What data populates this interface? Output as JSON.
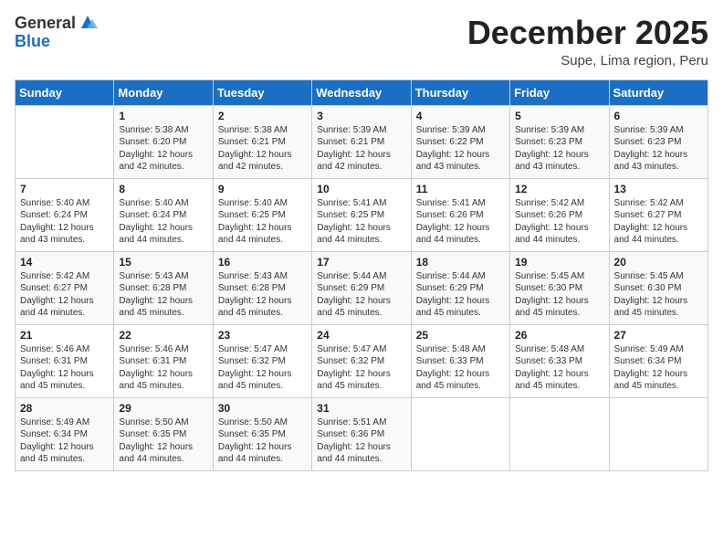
{
  "header": {
    "logo_general": "General",
    "logo_blue": "Blue",
    "month_title": "December 2025",
    "subtitle": "Supe, Lima region, Peru"
  },
  "days_of_week": [
    "Sunday",
    "Monday",
    "Tuesday",
    "Wednesday",
    "Thursday",
    "Friday",
    "Saturday"
  ],
  "weeks": [
    [
      {
        "day": "",
        "info": ""
      },
      {
        "day": "1",
        "info": "Sunrise: 5:38 AM\nSunset: 6:20 PM\nDaylight: 12 hours\nand 42 minutes."
      },
      {
        "day": "2",
        "info": "Sunrise: 5:38 AM\nSunset: 6:21 PM\nDaylight: 12 hours\nand 42 minutes."
      },
      {
        "day": "3",
        "info": "Sunrise: 5:39 AM\nSunset: 6:21 PM\nDaylight: 12 hours\nand 42 minutes."
      },
      {
        "day": "4",
        "info": "Sunrise: 5:39 AM\nSunset: 6:22 PM\nDaylight: 12 hours\nand 43 minutes."
      },
      {
        "day": "5",
        "info": "Sunrise: 5:39 AM\nSunset: 6:23 PM\nDaylight: 12 hours\nand 43 minutes."
      },
      {
        "day": "6",
        "info": "Sunrise: 5:39 AM\nSunset: 6:23 PM\nDaylight: 12 hours\nand 43 minutes."
      }
    ],
    [
      {
        "day": "7",
        "info": "Sunrise: 5:40 AM\nSunset: 6:24 PM\nDaylight: 12 hours\nand 43 minutes."
      },
      {
        "day": "8",
        "info": "Sunrise: 5:40 AM\nSunset: 6:24 PM\nDaylight: 12 hours\nand 44 minutes."
      },
      {
        "day": "9",
        "info": "Sunrise: 5:40 AM\nSunset: 6:25 PM\nDaylight: 12 hours\nand 44 minutes."
      },
      {
        "day": "10",
        "info": "Sunrise: 5:41 AM\nSunset: 6:25 PM\nDaylight: 12 hours\nand 44 minutes."
      },
      {
        "day": "11",
        "info": "Sunrise: 5:41 AM\nSunset: 6:26 PM\nDaylight: 12 hours\nand 44 minutes."
      },
      {
        "day": "12",
        "info": "Sunrise: 5:42 AM\nSunset: 6:26 PM\nDaylight: 12 hours\nand 44 minutes."
      },
      {
        "day": "13",
        "info": "Sunrise: 5:42 AM\nSunset: 6:27 PM\nDaylight: 12 hours\nand 44 minutes."
      }
    ],
    [
      {
        "day": "14",
        "info": "Sunrise: 5:42 AM\nSunset: 6:27 PM\nDaylight: 12 hours\nand 44 minutes."
      },
      {
        "day": "15",
        "info": "Sunrise: 5:43 AM\nSunset: 6:28 PM\nDaylight: 12 hours\nand 45 minutes."
      },
      {
        "day": "16",
        "info": "Sunrise: 5:43 AM\nSunset: 6:28 PM\nDaylight: 12 hours\nand 45 minutes."
      },
      {
        "day": "17",
        "info": "Sunrise: 5:44 AM\nSunset: 6:29 PM\nDaylight: 12 hours\nand 45 minutes."
      },
      {
        "day": "18",
        "info": "Sunrise: 5:44 AM\nSunset: 6:29 PM\nDaylight: 12 hours\nand 45 minutes."
      },
      {
        "day": "19",
        "info": "Sunrise: 5:45 AM\nSunset: 6:30 PM\nDaylight: 12 hours\nand 45 minutes."
      },
      {
        "day": "20",
        "info": "Sunrise: 5:45 AM\nSunset: 6:30 PM\nDaylight: 12 hours\nand 45 minutes."
      }
    ],
    [
      {
        "day": "21",
        "info": "Sunrise: 5:46 AM\nSunset: 6:31 PM\nDaylight: 12 hours\nand 45 minutes."
      },
      {
        "day": "22",
        "info": "Sunrise: 5:46 AM\nSunset: 6:31 PM\nDaylight: 12 hours\nand 45 minutes."
      },
      {
        "day": "23",
        "info": "Sunrise: 5:47 AM\nSunset: 6:32 PM\nDaylight: 12 hours\nand 45 minutes."
      },
      {
        "day": "24",
        "info": "Sunrise: 5:47 AM\nSunset: 6:32 PM\nDaylight: 12 hours\nand 45 minutes."
      },
      {
        "day": "25",
        "info": "Sunrise: 5:48 AM\nSunset: 6:33 PM\nDaylight: 12 hours\nand 45 minutes."
      },
      {
        "day": "26",
        "info": "Sunrise: 5:48 AM\nSunset: 6:33 PM\nDaylight: 12 hours\nand 45 minutes."
      },
      {
        "day": "27",
        "info": "Sunrise: 5:49 AM\nSunset: 6:34 PM\nDaylight: 12 hours\nand 45 minutes."
      }
    ],
    [
      {
        "day": "28",
        "info": "Sunrise: 5:49 AM\nSunset: 6:34 PM\nDaylight: 12 hours\nand 45 minutes."
      },
      {
        "day": "29",
        "info": "Sunrise: 5:50 AM\nSunset: 6:35 PM\nDaylight: 12 hours\nand 44 minutes."
      },
      {
        "day": "30",
        "info": "Sunrise: 5:50 AM\nSunset: 6:35 PM\nDaylight: 12 hours\nand 44 minutes."
      },
      {
        "day": "31",
        "info": "Sunrise: 5:51 AM\nSunset: 6:36 PM\nDaylight: 12 hours\nand 44 minutes."
      },
      {
        "day": "",
        "info": ""
      },
      {
        "day": "",
        "info": ""
      },
      {
        "day": "",
        "info": ""
      }
    ]
  ]
}
